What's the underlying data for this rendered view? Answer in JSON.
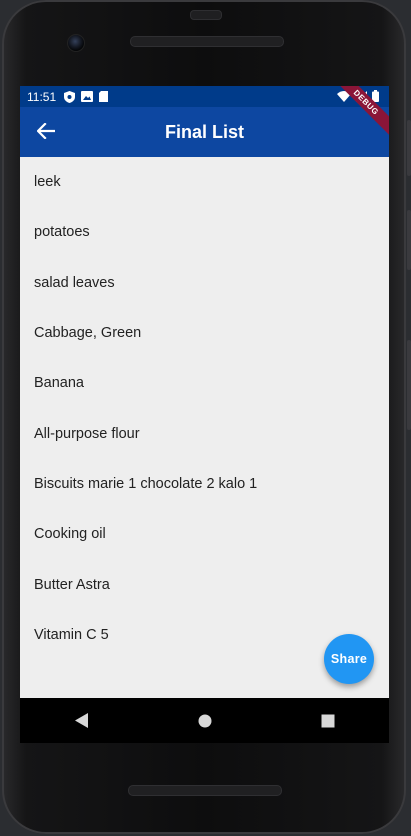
{
  "status_bar": {
    "time": "11:51",
    "icons_left": [
      "shield-icon",
      "image-icon",
      "sd-card-icon"
    ],
    "icons_right": [
      "wifi-icon",
      "signal-icon",
      "battery-icon"
    ]
  },
  "app_bar": {
    "title": "Final List",
    "back_icon": "arrow-left-icon"
  },
  "debug_banner": "DEBUG",
  "list": {
    "items": [
      "leek",
      "potatoes",
      "salad leaves",
      "Cabbage, Green",
      "Banana",
      "All-purpose flour",
      "Biscuits marie 1 chocolate 2 kalo 1",
      "Cooking oil",
      "Butter  Astra",
      "Vitamin C 5"
    ]
  },
  "fab": {
    "label": "Share"
  },
  "colors": {
    "status_bar": "#003b8a",
    "app_bar": "#0d47a1",
    "fab": "#2196f3",
    "background": "#eeeeee",
    "debug_banner": "#8b1538"
  }
}
